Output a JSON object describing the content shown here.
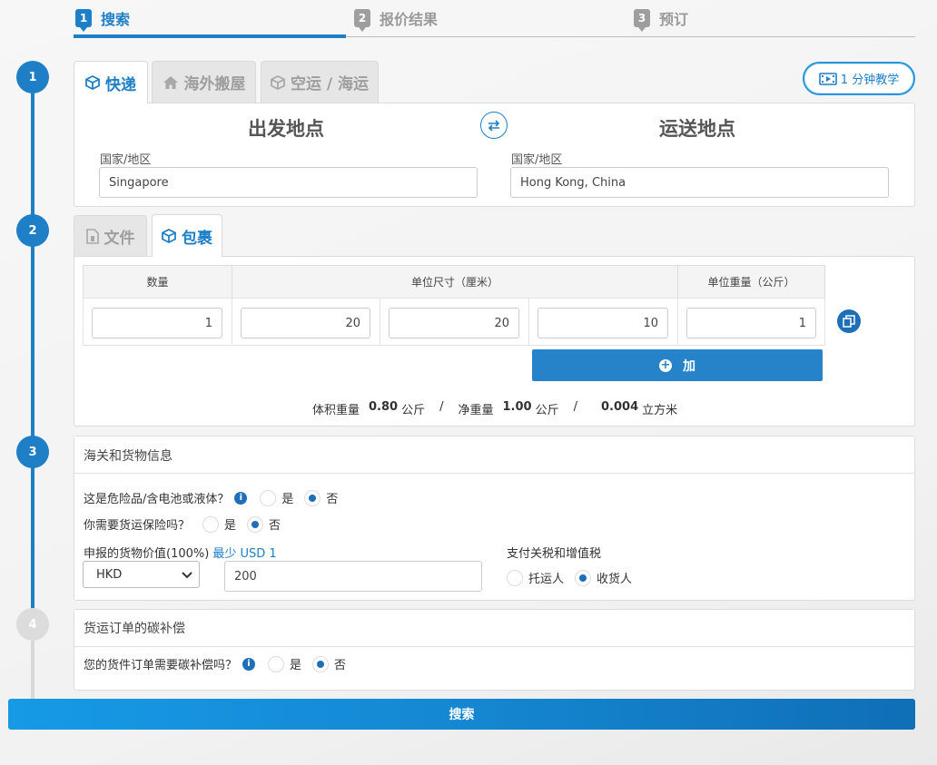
{
  "stepbar": {
    "steps": [
      {
        "num": "1",
        "label": "搜索"
      },
      {
        "num": "2",
        "label": "报价结果"
      },
      {
        "num": "3",
        "label": "预订"
      }
    ]
  },
  "timeline": [
    "1",
    "2",
    "3",
    "4"
  ],
  "service_tabs": [
    {
      "label": "快递",
      "icon": "box-icon"
    },
    {
      "label": "海外搬屋",
      "icon": "house-icon"
    },
    {
      "label": "空运 / 海运",
      "icon": "crate-icon"
    }
  ],
  "video_button": {
    "label": "1 分钟教学"
  },
  "route": {
    "origin_heading": "出发地点",
    "destination_heading": "运送地点",
    "origin_label": "国家/地区",
    "destination_label": "国家/地区",
    "origin_value": "Singapore",
    "destination_value": "Hong Kong, China"
  },
  "parcel_tabs": [
    {
      "label": "文件",
      "icon": "document-icon"
    },
    {
      "label": "包裹",
      "icon": "box-icon"
    }
  ],
  "package_table": {
    "col_quantity": "数量",
    "col_dimensions": "单位尺寸（厘米）",
    "col_weight": "单位重量（公斤）",
    "quantity": "1",
    "length": "20",
    "width": "20",
    "height": "10",
    "weight": "1",
    "add_label": "加"
  },
  "summary": {
    "volumetric_label": "体积重量",
    "volumetric_value": "0.80",
    "unit_kg": "公斤",
    "sep": "/",
    "net_label": "净重量",
    "net_value": "1.00",
    "volume_value": "0.004",
    "unit_m3": "立方米"
  },
  "customs": {
    "title": "海关和货物信息",
    "dangerous_q": "这是危险品/含电池或液体？",
    "insurance_q": "你需要货运保险吗？",
    "yes": "是",
    "no": "否",
    "declared_label": "申报的货物价值(100%)",
    "min_label": "最少 USD 1",
    "currency": "HKD",
    "declared_value": "200",
    "duties_label": "支付关税和增值税",
    "shipper": "托运人",
    "consignee": "收货人"
  },
  "carbon": {
    "title": "货运订单的碳补偿",
    "question": "您的货件订单需要碳补偿吗？",
    "yes": "是",
    "no": "否"
  },
  "search_button": {
    "label": "搜索"
  }
}
